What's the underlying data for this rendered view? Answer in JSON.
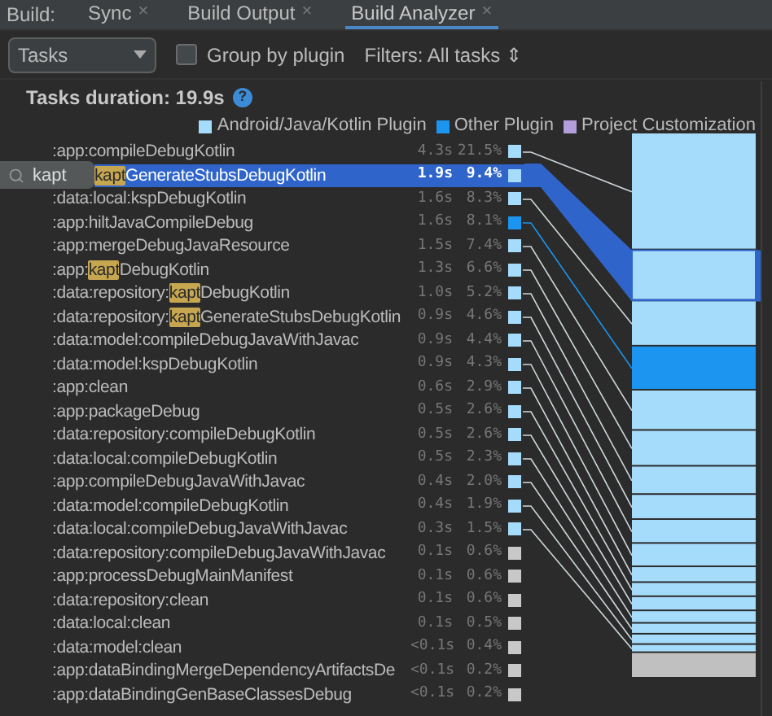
{
  "tab_bar": {
    "label": "Build:",
    "tabs": [
      {
        "label": "Sync",
        "close": "×",
        "selected": false
      },
      {
        "label": "Build Output",
        "close": "×",
        "selected": false
      },
      {
        "label": "Build Analyzer",
        "close": "×",
        "selected": true
      }
    ]
  },
  "toolbar": {
    "view_select": "Tasks",
    "group_by_plugin": {
      "label": "Group by plugin",
      "checked": false
    },
    "filters": "Filters: All tasks ⇕"
  },
  "summary": {
    "title": "Tasks duration: 19.9s",
    "help": "?"
  },
  "legend": [
    {
      "label": "Android/Java/Kotlin Plugin",
      "color": "#a5dbfb"
    },
    {
      "label": "Other Plugin",
      "color": "#1b95ef"
    },
    {
      "label": "Project Customization",
      "color": "#b39ddb"
    }
  ],
  "search": {
    "value": "kapt"
  },
  "tasks": [
    {
      "parts": [
        {
          "text": ":app:compileDebugKotlin",
          "match": false
        }
      ],
      "duration": "4.3s",
      "percent": "21.5%",
      "color": "#a5dbfb",
      "selected": false
    },
    {
      "parts": [
        {
          "text": "kapt",
          "match": true
        },
        {
          "text": "GenerateStubsDebugKotlin",
          "match": false
        }
      ],
      "duration": "1.9s",
      "percent": "9.4%",
      "color": "#a5dbfb",
      "selected": true
    },
    {
      "parts": [
        {
          "text": ":data:local:kspDebugKotlin",
          "match": false
        }
      ],
      "duration": "1.6s",
      "percent": "8.3%",
      "color": "#a5dbfb",
      "selected": false
    },
    {
      "parts": [
        {
          "text": ":app:hiltJavaCompileDebug",
          "match": false
        }
      ],
      "duration": "1.6s",
      "percent": "8.1%",
      "color": "#1b95ef",
      "selected": false
    },
    {
      "parts": [
        {
          "text": ":app:mergeDebugJavaResource",
          "match": false
        }
      ],
      "duration": "1.5s",
      "percent": "7.4%",
      "color": "#a5dbfb",
      "selected": false
    },
    {
      "parts": [
        {
          "text": ":app:",
          "match": false
        },
        {
          "text": "kapt",
          "match": true
        },
        {
          "text": "DebugKotlin",
          "match": false
        }
      ],
      "duration": "1.3s",
      "percent": "6.6%",
      "color": "#a5dbfb",
      "selected": false
    },
    {
      "parts": [
        {
          "text": ":data:repository:",
          "match": false
        },
        {
          "text": "kapt",
          "match": true
        },
        {
          "text": "DebugKotlin",
          "match": false
        }
      ],
      "duration": "1.0s",
      "percent": "5.2%",
      "color": "#a5dbfb",
      "selected": false
    },
    {
      "parts": [
        {
          "text": ":data:repository:",
          "match": false
        },
        {
          "text": "kapt",
          "match": true
        },
        {
          "text": "GenerateStubsDebugKotlin",
          "match": false
        }
      ],
      "duration": "0.9s",
      "percent": "4.6%",
      "color": "#a5dbfb",
      "selected": false
    },
    {
      "parts": [
        {
          "text": ":data:model:compileDebugJavaWithJavac",
          "match": false
        }
      ],
      "duration": "0.9s",
      "percent": "4.4%",
      "color": "#a5dbfb",
      "selected": false
    },
    {
      "parts": [
        {
          "text": ":data:model:kspDebugKotlin",
          "match": false
        }
      ],
      "duration": "0.9s",
      "percent": "4.3%",
      "color": "#a5dbfb",
      "selected": false
    },
    {
      "parts": [
        {
          "text": ":app:clean",
          "match": false
        }
      ],
      "duration": "0.6s",
      "percent": "2.9%",
      "color": "#a5dbfb",
      "selected": false
    },
    {
      "parts": [
        {
          "text": ":app:packageDebug",
          "match": false
        }
      ],
      "duration": "0.5s",
      "percent": "2.6%",
      "color": "#a5dbfb",
      "selected": false
    },
    {
      "parts": [
        {
          "text": ":data:repository:compileDebugKotlin",
          "match": false
        }
      ],
      "duration": "0.5s",
      "percent": "2.6%",
      "color": "#a5dbfb",
      "selected": false
    },
    {
      "parts": [
        {
          "text": ":data:local:compileDebugKotlin",
          "match": false
        }
      ],
      "duration": "0.5s",
      "percent": "2.3%",
      "color": "#a5dbfb",
      "selected": false
    },
    {
      "parts": [
        {
          "text": ":app:compileDebugJavaWithJavac",
          "match": false
        }
      ],
      "duration": "0.4s",
      "percent": "2.0%",
      "color": "#a5dbfb",
      "selected": false
    },
    {
      "parts": [
        {
          "text": ":data:model:compileDebugKotlin",
          "match": false
        }
      ],
      "duration": "0.4s",
      "percent": "1.9%",
      "color": "#a5dbfb",
      "selected": false
    },
    {
      "parts": [
        {
          "text": ":data:local:compileDebugJavaWithJavac",
          "match": false
        }
      ],
      "duration": "0.3s",
      "percent": "1.5%",
      "color": "#a5dbfb",
      "selected": false
    },
    {
      "parts": [
        {
          "text": ":data:repository:compileDebugJavaWithJavac",
          "match": false
        }
      ],
      "duration": "0.1s",
      "percent": "0.6%",
      "color": "#c8c8c8",
      "selected": false
    },
    {
      "parts": [
        {
          "text": ":app:processDebugMainManifest",
          "match": false
        }
      ],
      "duration": "0.1s",
      "percent": "0.6%",
      "color": "#c8c8c8",
      "selected": false
    },
    {
      "parts": [
        {
          "text": ":data:repository:clean",
          "match": false
        }
      ],
      "duration": "0.1s",
      "percent": "0.6%",
      "color": "#c8c8c8",
      "selected": false
    },
    {
      "parts": [
        {
          "text": ":data:local:clean",
          "match": false
        }
      ],
      "duration": "0.1s",
      "percent": "0.5%",
      "color": "#c8c8c8",
      "selected": false
    },
    {
      "parts": [
        {
          "text": ":data:model:clean",
          "match": false
        }
      ],
      "duration": "<0.1s",
      "percent": "0.4%",
      "color": "#c8c8c8",
      "selected": false
    },
    {
      "parts": [
        {
          "text": ":app:dataBindingMergeDependencyArtifactsDe",
          "match": false
        }
      ],
      "duration": "<0.1s",
      "percent": "0.2%",
      "color": "#c8c8c8",
      "selected": false
    },
    {
      "parts": [
        {
          "text": ":app:dataBindingGenBaseClassesDebug",
          "match": false
        }
      ],
      "duration": "<0.1s",
      "percent": "0.2%",
      "color": "#c8c8c8",
      "selected": false
    }
  ]
}
